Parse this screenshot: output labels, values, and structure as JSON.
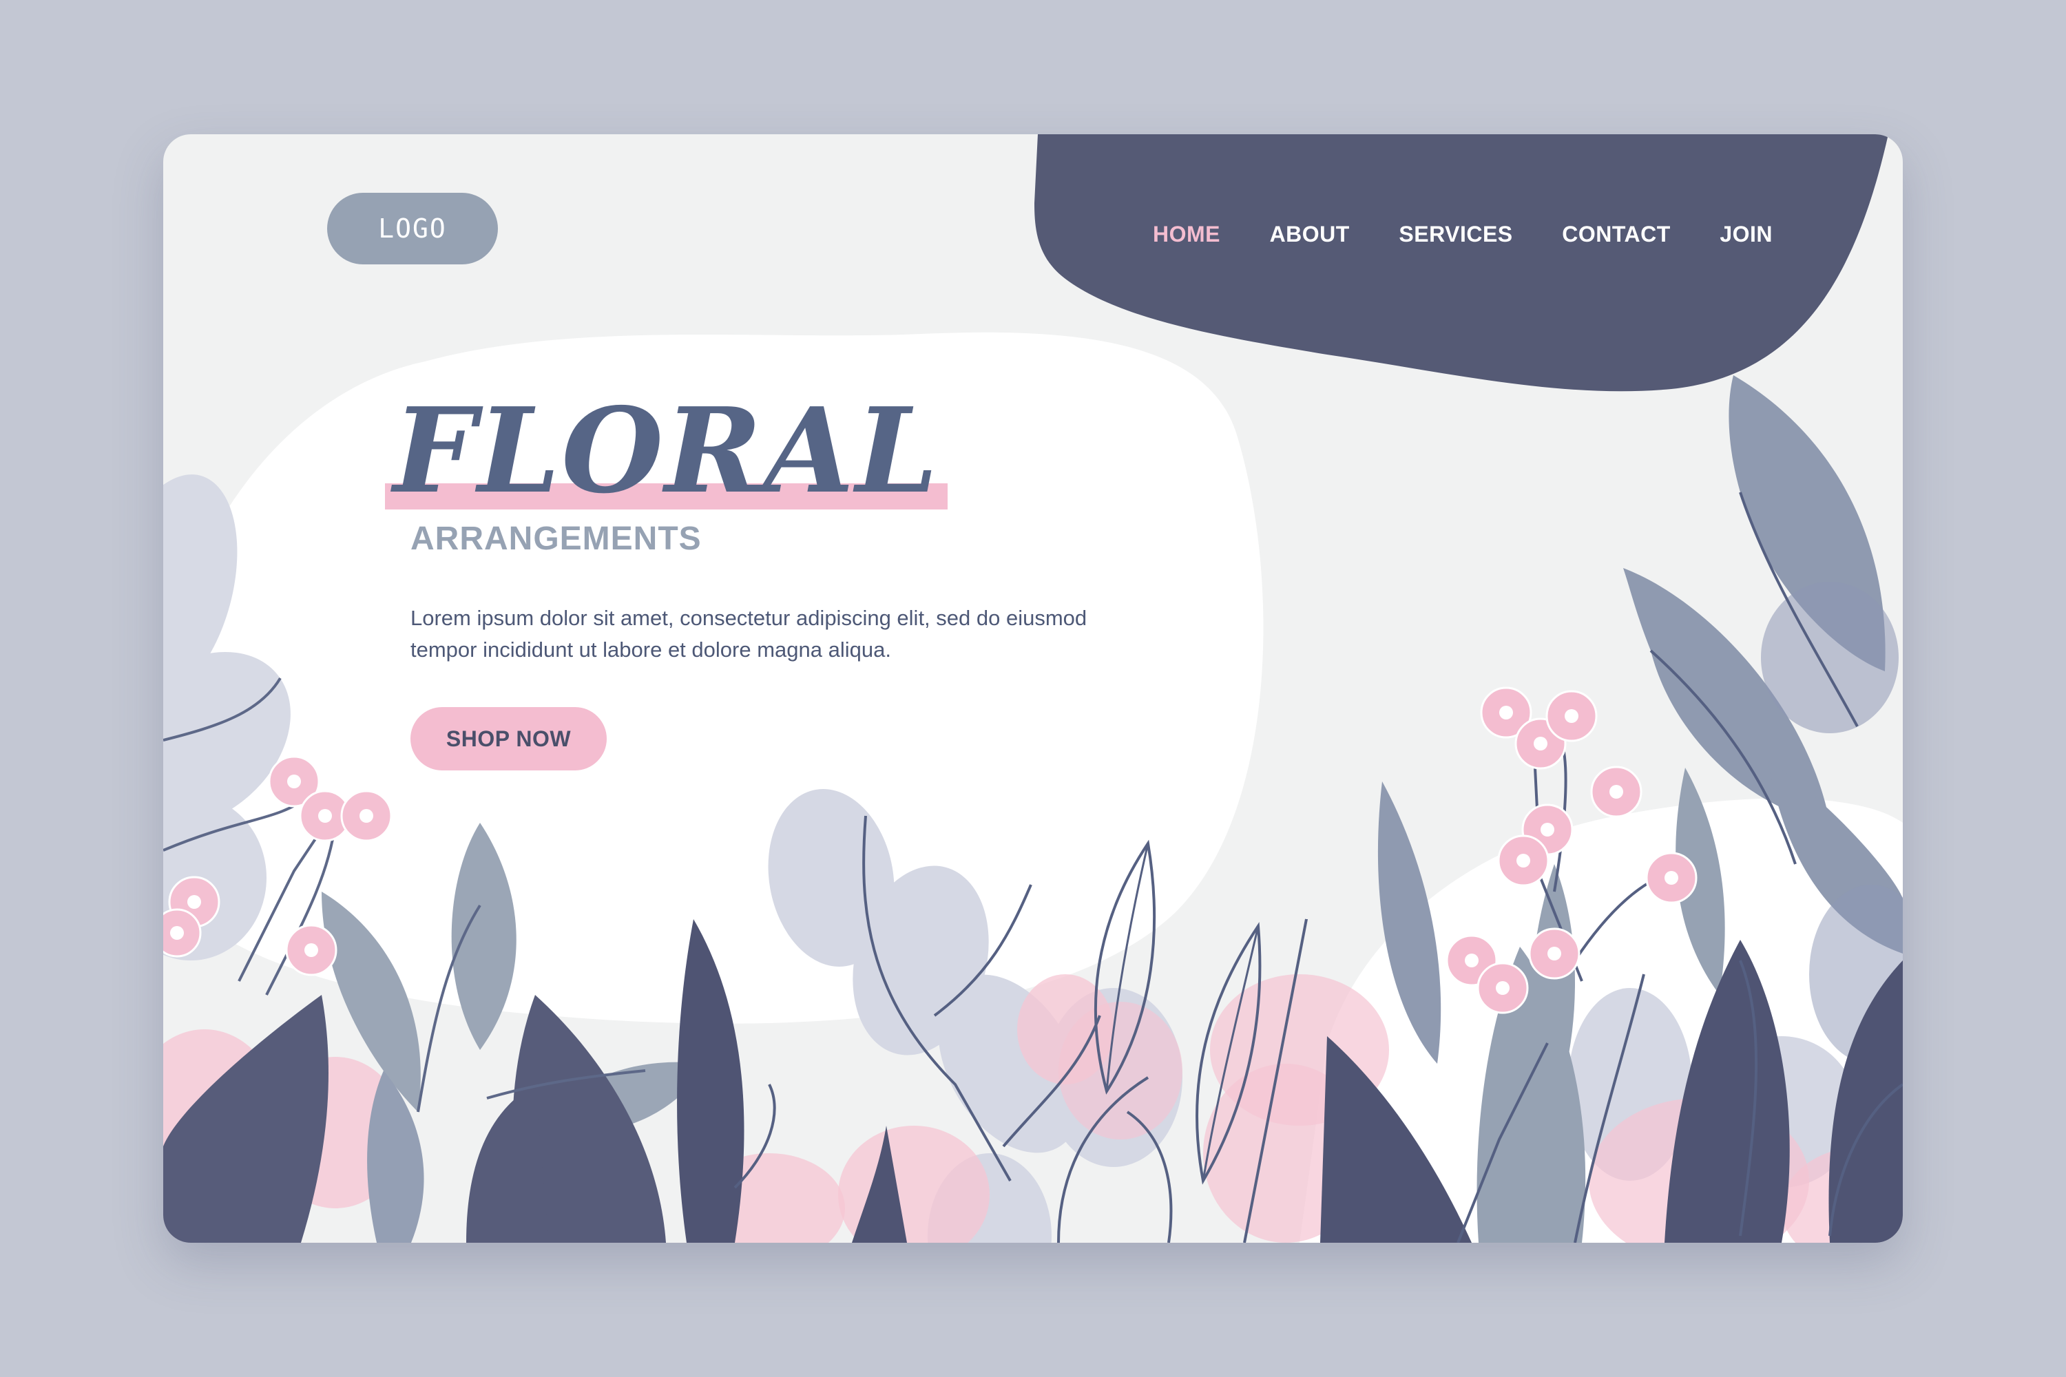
{
  "logo": {
    "text": "LOGO"
  },
  "nav": {
    "items": [
      {
        "label": "HOME",
        "active": true
      },
      {
        "label": "ABOUT",
        "active": false
      },
      {
        "label": "SERVICES",
        "active": false
      },
      {
        "label": "CONTACT",
        "active": false
      },
      {
        "label": "JOIN",
        "active": false
      }
    ]
  },
  "hero": {
    "title": "FLORAL",
    "subtitle": "ARRANGEMENTS",
    "body": "Lorem ipsum dolor sit amet, consectetur adipiscing elit, sed do eiusmod tempor incididunt ut labore et dolore magna aliqua.",
    "cta_label": "SHOP NOW"
  },
  "colors": {
    "page_background": "#c3c7d3",
    "card_background": "#f1f2f2",
    "nav_background": "#555a75",
    "accent_pink": "#f4bdd0",
    "title_blue": "#566586",
    "muted_gray_blue": "#96a2b3",
    "dark_leaf": "#4f5473"
  },
  "decorations": {
    "illustration": "floral-leaves-illustration"
  }
}
